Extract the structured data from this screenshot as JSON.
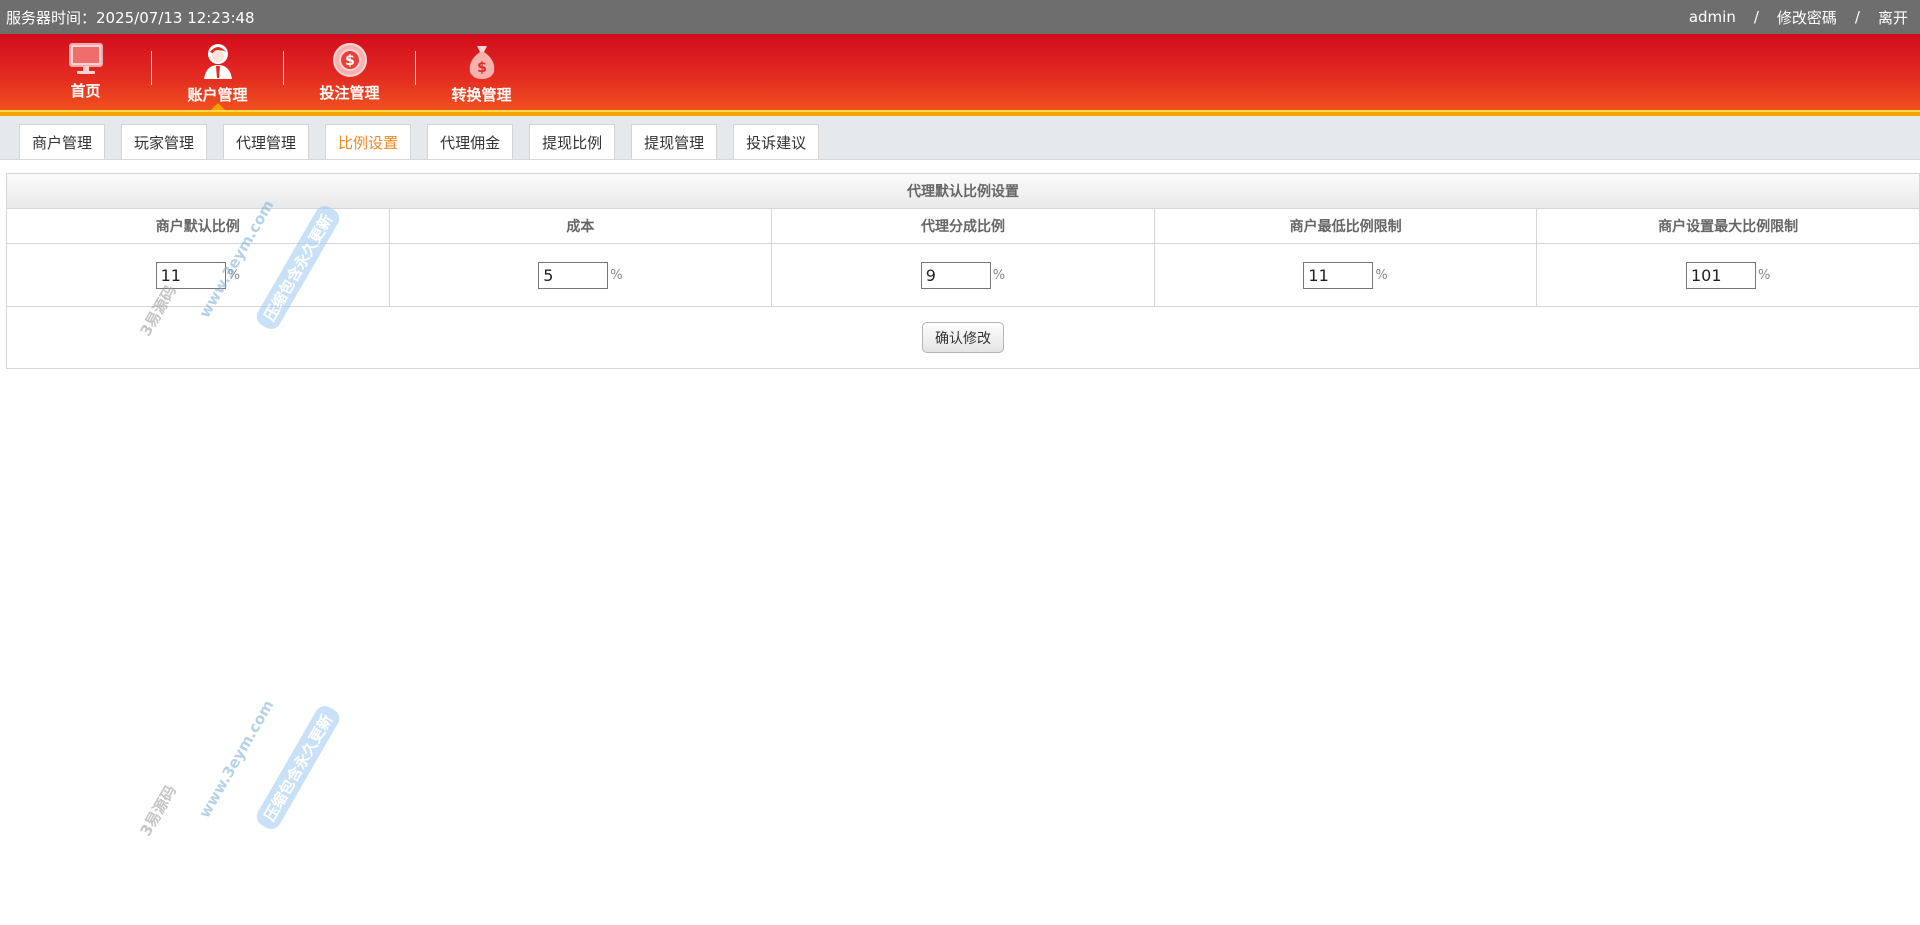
{
  "topbar": {
    "server_time": "服务器时间：2025/07/13 12:23:48",
    "user": "admin",
    "sep1": "/",
    "change_password": "修改密碼",
    "sep2": "/",
    "logout": "离开"
  },
  "nav": {
    "items": [
      {
        "label": "首页",
        "icon": "monitor-icon"
      },
      {
        "label": "账户管理",
        "icon": "user-icon"
      },
      {
        "label": "投注管理",
        "icon": "chip-icon"
      },
      {
        "label": "转换管理",
        "icon": "money-bag-icon"
      }
    ],
    "active_index": 1
  },
  "subtabs": {
    "items": [
      "商户管理",
      "玩家管理",
      "代理管理",
      "比例设置",
      "代理佣金",
      "提现比例",
      "提现管理",
      "投诉建议"
    ],
    "active_index": 3
  },
  "panel": {
    "title": "代理默认比例设置",
    "headers": [
      "商户默认比例",
      "成本",
      "代理分成比例",
      "商户最低比例限制",
      "商户设置最大比例限制"
    ],
    "values": [
      "11",
      "5",
      "9",
      "11",
      "101"
    ],
    "unit": "%",
    "submit_label": "确认修改"
  },
  "watermark": {
    "text1": "www.3eym.com",
    "text2": "压缩包含永久更新",
    "text3": "3易源码"
  },
  "colors": {
    "nav_red": "#d20c1c",
    "active_tab": "#f08a28",
    "accent_yellow": "#f5a300"
  }
}
